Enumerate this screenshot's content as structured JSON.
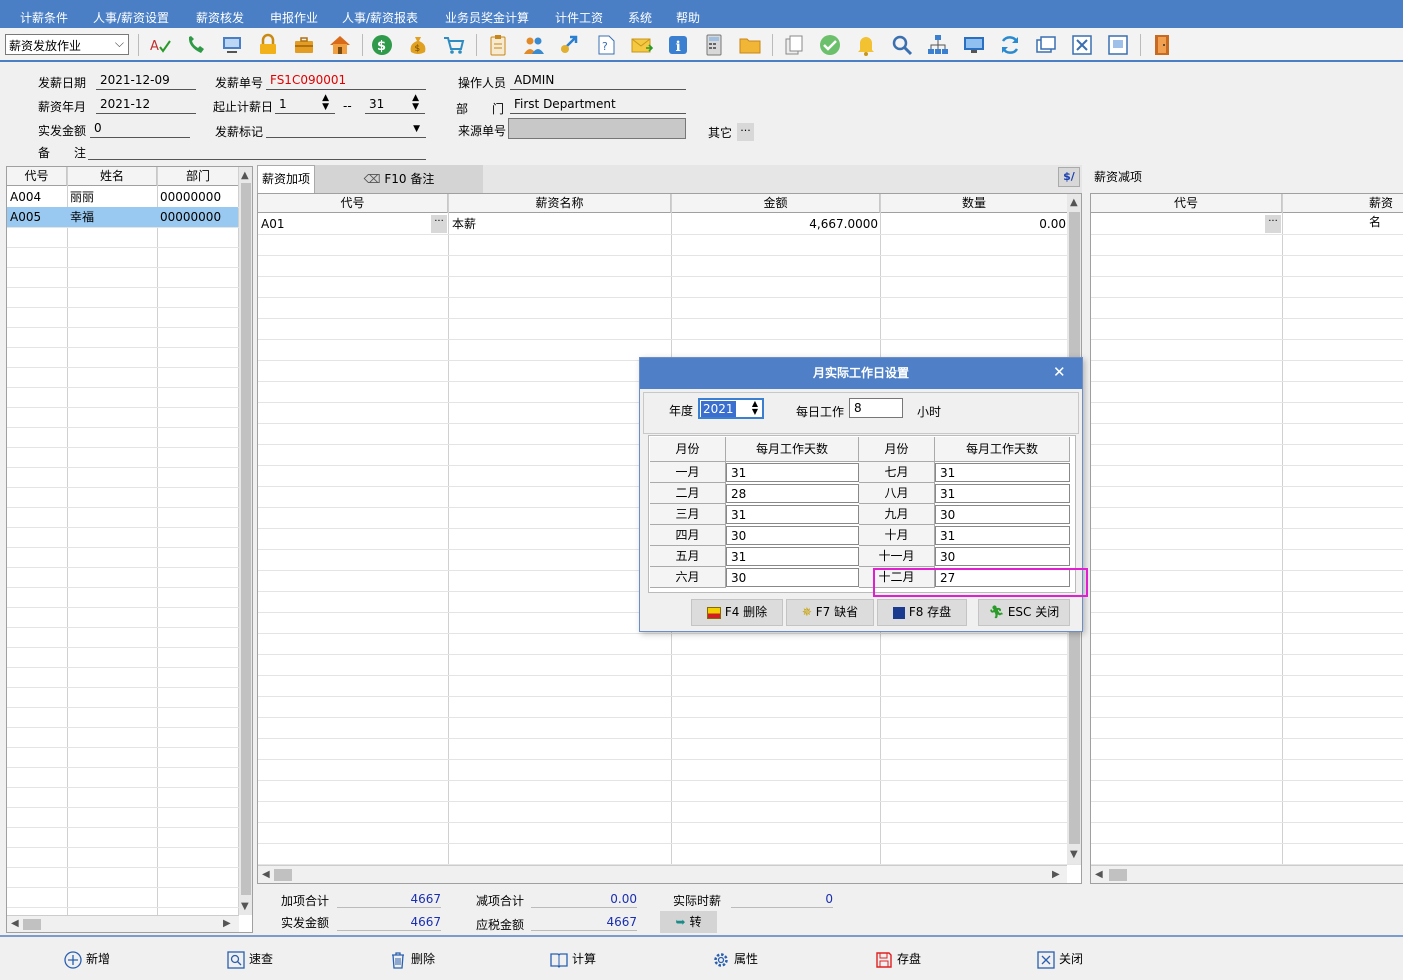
{
  "menu": [
    "计薪条件",
    "人事/薪资设置",
    "薪资核发",
    "申报作业",
    "人事/薪资报表",
    "业务员奖金计算",
    "计件工资",
    "系统",
    "帮助"
  ],
  "toolbar": {
    "module_select": "薪资发放作业"
  },
  "colors": {
    "menubar": "#4a7fc6",
    "dialog_title": "#4f80c7",
    "highlight": "#e020d0",
    "selected_row": "#99c9f0",
    "red_text": "#e00000",
    "sum_blue": "#1a2fb0"
  },
  "header": {
    "pay_date_label": "发薪日期",
    "pay_date": "2021-12-09",
    "pay_no_label": "发薪单号",
    "pay_no": "FS1C090001",
    "operator_label": "操作人员",
    "operator": "ADMIN",
    "salary_month_label": "薪资年月",
    "salary_month": "2021-12",
    "start_end_label": "起止计薪日",
    "start_day": "1",
    "range_sep": "--",
    "end_day": "31",
    "dept_label_a": "部",
    "dept_label_b": "门",
    "dept": "First Department",
    "actual_label": "实发金额",
    "actual": "0",
    "flag_label": "发薪标记",
    "flag": "",
    "source_label": "来源单号",
    "source": "",
    "remark_label_a": "备",
    "remark_label_b": "注",
    "remark": "",
    "other_label": "其它",
    "ellipsis": "···"
  },
  "employees": {
    "columns": [
      "代号",
      "姓名",
      "部门"
    ],
    "rows": [
      {
        "code": "A004",
        "name": "丽丽",
        "dept": "00000000"
      },
      {
        "code": "A005",
        "name": "幸福",
        "dept": "00000000"
      }
    ]
  },
  "additions": {
    "tab_label": "薪资加项",
    "tab_remark": "F10 备注",
    "corner_icon": "$/",
    "columns": [
      "代号",
      "薪资名称",
      "金额",
      "数量"
    ],
    "rows": [
      {
        "code": "A01",
        "name": "本薪",
        "amount": "4,667.0000",
        "qty": "0.00"
      }
    ]
  },
  "deductions": {
    "tab_label": "薪资减项",
    "columns": [
      "代号",
      "薪资名"
    ]
  },
  "summary": {
    "add_total_label": "加项合计",
    "add_total": "4667",
    "ded_total_label": "减项合计",
    "ded_total": "0.00",
    "actual_hourly_label": "实际时薪",
    "actual_hourly": "0",
    "actual_amount_label": "实发金额",
    "actual_amount": "4667",
    "taxable_label": "应税金额",
    "taxable": "4667",
    "convert_label": "转"
  },
  "dialog": {
    "title": "月实际工作日设置",
    "close": "✕",
    "year_label": "年度",
    "year": "2021",
    "daily_label": "每日工作",
    "daily_hours": "8",
    "hours_unit": "小时",
    "col_month": "月份",
    "col_days": "每月工作天数",
    "left_months": [
      {
        "month": "一月",
        "days": "31"
      },
      {
        "month": "二月",
        "days": "28"
      },
      {
        "month": "三月",
        "days": "31"
      },
      {
        "month": "四月",
        "days": "30"
      },
      {
        "month": "五月",
        "days": "31"
      },
      {
        "month": "六月",
        "days": "30"
      }
    ],
    "right_months": [
      {
        "month": "七月",
        "days": "31"
      },
      {
        "month": "八月",
        "days": "31"
      },
      {
        "month": "九月",
        "days": "30"
      },
      {
        "month": "十月",
        "days": "31"
      },
      {
        "month": "十一月",
        "days": "30"
      },
      {
        "month": "十二月",
        "days": "27"
      }
    ],
    "buttons": {
      "delete": "F4 删除",
      "default": "F7 缺省",
      "save": "F8 存盘",
      "close": "ESC 关闭"
    }
  },
  "bottom": {
    "add": "新增",
    "query": "速查",
    "delete": "删除",
    "calc": "计算",
    "props": "属性",
    "save": "存盘",
    "close": "关闭"
  }
}
